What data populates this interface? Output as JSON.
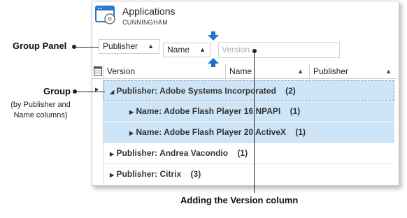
{
  "app": {
    "title": "Applications",
    "subtitle": "CUNNINGHAM"
  },
  "group_panel": {
    "chips": [
      {
        "label": "Publisher",
        "sort": "▲"
      },
      {
        "label": "Name",
        "sort": "▲"
      }
    ],
    "drop_placeholder": "Version"
  },
  "columns": [
    {
      "label": "Version",
      "sort": ""
    },
    {
      "label": "Name",
      "sort": "▲"
    },
    {
      "label": "Publisher",
      "sort": "▲"
    }
  ],
  "rows": [
    {
      "label": "Publisher: Adobe Systems Incorporated",
      "count": "(2)",
      "expand": "◢",
      "level": 0,
      "selected": true
    },
    {
      "label": "Name: Adobe Flash Player 16 NPAPI",
      "count": "(1)",
      "expand": "▶",
      "level": 1,
      "selected": true
    },
    {
      "label": "Name: Adobe Flash Player 20 ActiveX",
      "count": "(1)",
      "expand": "▶",
      "level": 1,
      "selected": true
    },
    {
      "label": "Publisher: Andrea Vacondio",
      "count": "(1)",
      "expand": "▶",
      "level": 0,
      "selected": false
    },
    {
      "label": "Publisher: Citrix",
      "count": "(3)",
      "expand": "▶",
      "level": 0,
      "selected": false
    }
  ],
  "annotations": {
    "group_panel": "Group Panel",
    "group": "Group",
    "group_note": "(by Publisher and Name columns)",
    "group_note_line1": "(by Publisher and",
    "group_note_line2": "Name columns)",
    "adding_version": "Adding the Version column"
  },
  "colors": {
    "selection": "#cde5f7",
    "accent_arrow": "#1a73c9"
  }
}
